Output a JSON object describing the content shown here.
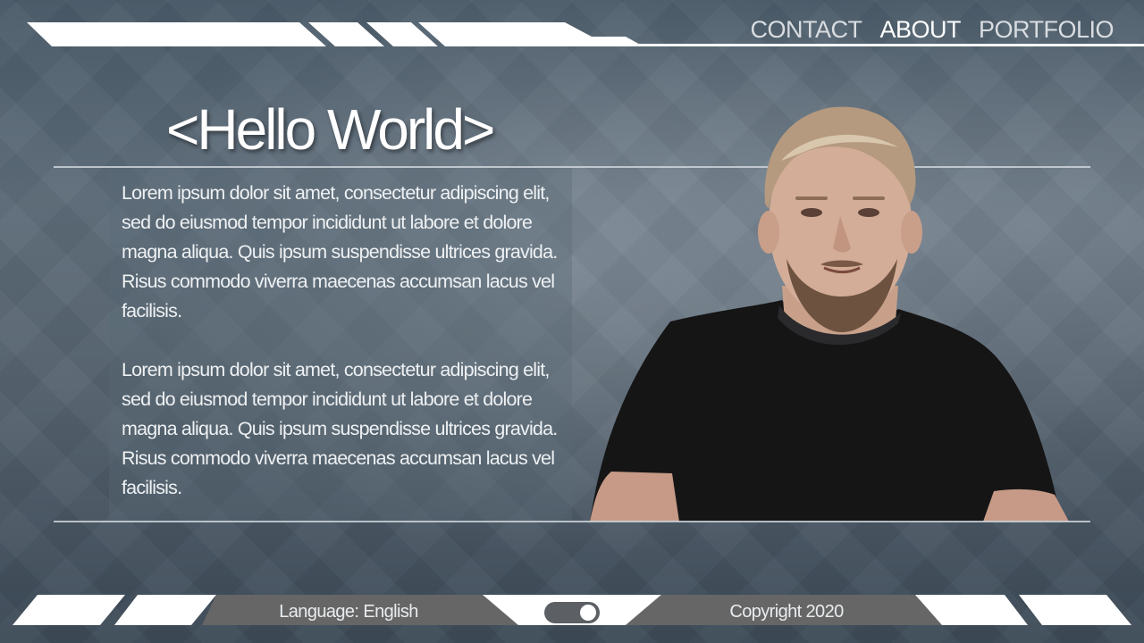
{
  "nav": {
    "links": [
      {
        "label": "CONTACT",
        "active": false
      },
      {
        "label": "ABOUT",
        "active": true
      },
      {
        "label": "PORTFOLIO",
        "active": false
      }
    ]
  },
  "main": {
    "title": "<Hello World>",
    "paragraphs": [
      "Lorem ipsum dolor sit amet, consectetur adipiscing elit, sed do eiusmod tempor incididunt ut labore et dolore magna aliqua. Quis ipsum suspendisse ultrices gravida. Risus commodo viverra maecenas accumsan lacus vel facilisis.",
      "Lorem ipsum dolor sit amet, consectetur adipiscing elit, sed do eiusmod tempor incididunt ut labore et dolore magna aliqua. Quis ipsum suspendisse ultrices gravida. Risus commodo viverra maecenas accumsan lacus vel facilisis."
    ]
  },
  "footer": {
    "language": "Language: English",
    "copyright": "Copyright 2020",
    "toggle_on": true
  },
  "colors": {
    "panel_white": "#ffffff",
    "footer_gray": "#6a6a6a",
    "background": "#56636f"
  }
}
